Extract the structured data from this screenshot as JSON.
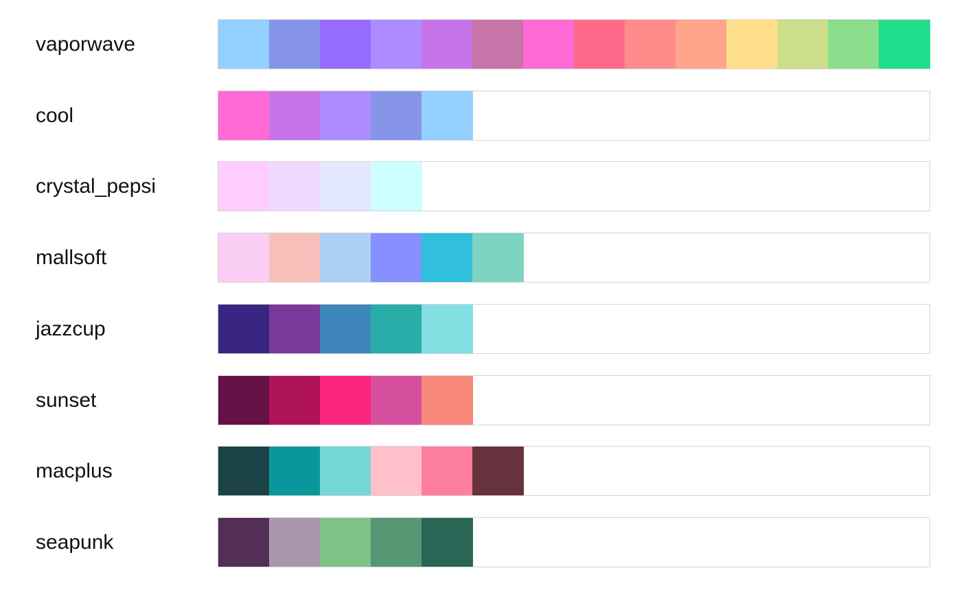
{
  "chart_data": {
    "type": "table",
    "max_swatches": 14,
    "palettes": [
      {
        "name": "vaporwave",
        "colors": [
          "#94D0FF",
          "#8795E8",
          "#966BFF",
          "#AD8CFF",
          "#C774E8",
          "#C774A9",
          "#FF6AD5",
          "#FF6A8B",
          "#FF8B8B",
          "#FFA58B",
          "#FFDE8B",
          "#CDDE8B",
          "#8BDE8B",
          "#20DE8B"
        ]
      },
      {
        "name": "cool",
        "colors": [
          "#FF6AD5",
          "#C774E8",
          "#AD8CFF",
          "#8795E8",
          "#94D0FF"
        ]
      },
      {
        "name": "crystal_pepsi",
        "colors": [
          "#FFCCFF",
          "#F1DAFF",
          "#E3E8FF",
          "#CCFFFF"
        ]
      },
      {
        "name": "mallsoft",
        "colors": [
          "#FBCFF3",
          "#F7C0BB",
          "#ACD0F4",
          "#8690FF",
          "#30BFDD",
          "#7FD4C1"
        ]
      },
      {
        "name": "jazzcup",
        "colors": [
          "#392682",
          "#7A3A9A",
          "#3F86BC",
          "#28ADA8",
          "#83DFE2"
        ]
      },
      {
        "name": "sunset",
        "colors": [
          "#661246",
          "#AE1357",
          "#F9247E",
          "#D7509F",
          "#F9897B"
        ]
      },
      {
        "name": "macplus",
        "colors": [
          "#1B4247",
          "#09979B",
          "#75D8D5",
          "#FFC0CB",
          "#FE7F9D",
          "#65323E"
        ]
      },
      {
        "name": "seapunk",
        "colors": [
          "#532E57",
          "#A997AB",
          "#7EC488",
          "#569874",
          "#296656"
        ]
      }
    ]
  }
}
